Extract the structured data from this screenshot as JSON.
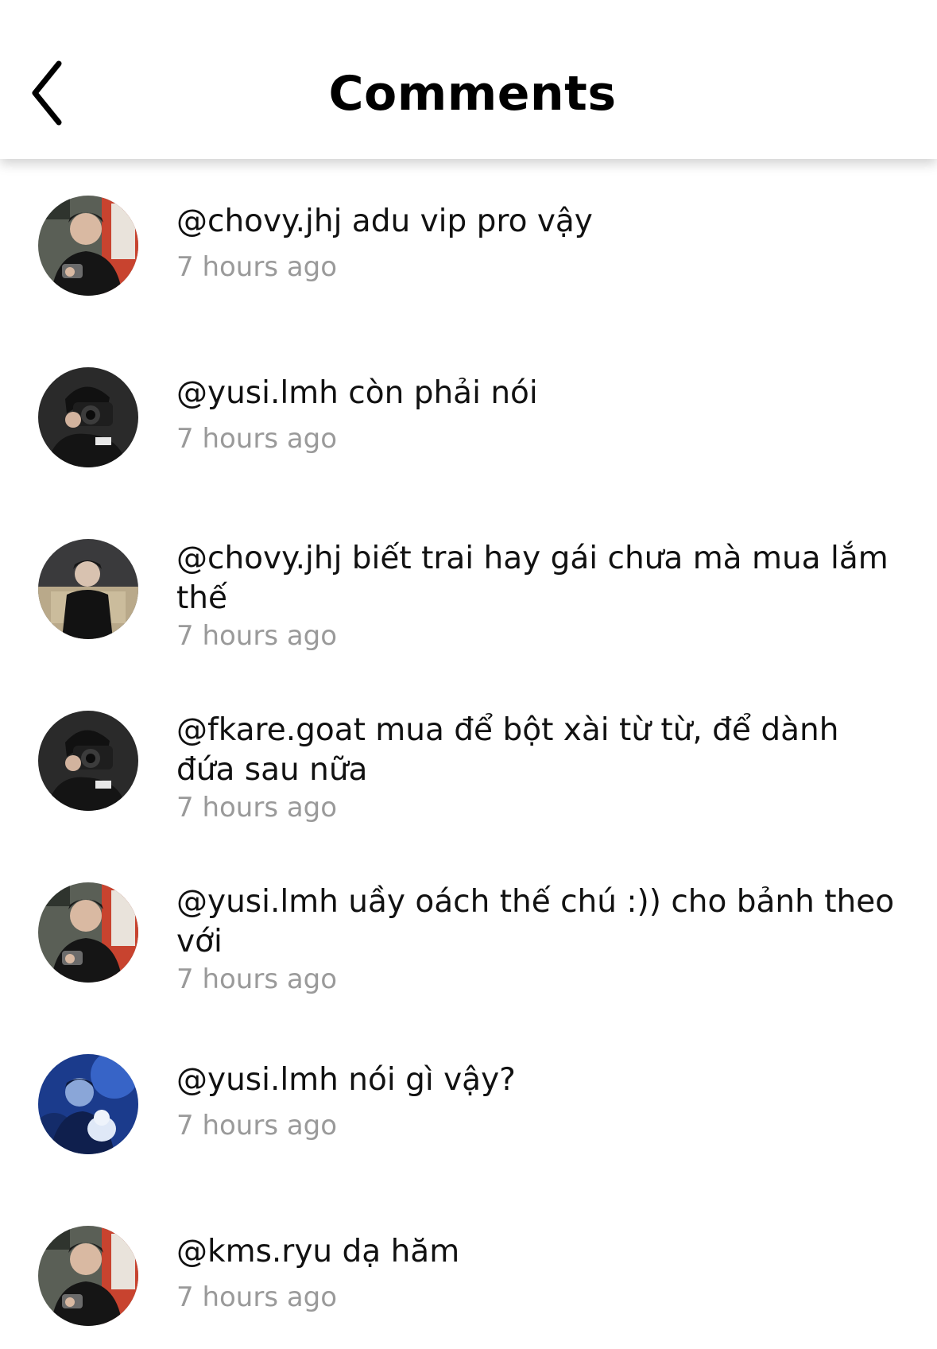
{
  "header": {
    "title": "Comments",
    "back_icon": "chevron-left-icon"
  },
  "comments": [
    {
      "text": "@chovy.jhj adu vip pro vậy",
      "time": "7 hours ago",
      "avatar": "player-red-chair"
    },
    {
      "text": "@yusi.lmh còn phải nói",
      "time": "7 hours ago",
      "avatar": "camera-portrait"
    },
    {
      "text": "@chovy.jhj biết trai hay gái chưa mà mua lắm thế",
      "time": "7 hours ago",
      "avatar": "sofa-portrait"
    },
    {
      "text": "@fkare.goat mua để bột xài từ từ, để dành đứa sau nữa",
      "time": "7 hours ago",
      "avatar": "camera-portrait"
    },
    {
      "text": "@yusi.lmh uầy oách thế chú :)) cho bảnh theo với",
      "time": "7 hours ago",
      "avatar": "player-red-chair"
    },
    {
      "text": "@yusi.lmh nói gì vậy?",
      "time": "7 hours ago",
      "avatar": "blue-stage"
    },
    {
      "text": "@kms.ryu dạ hăm",
      "time": "7 hours ago",
      "avatar": "player-red-chair"
    }
  ],
  "colors": {
    "text": "#111111",
    "timestamp": "#9a9a9a",
    "background": "#ffffff"
  }
}
